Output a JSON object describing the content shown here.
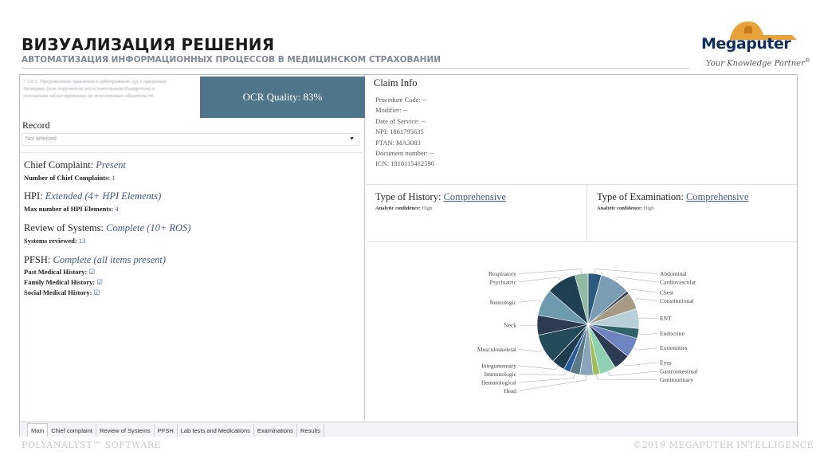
{
  "slide": {
    "title": "ВИЗУАЛИЗАЦИЯ РЕШЕНИЯ",
    "subtitle": "АВТОМАТИЗАЦИЯ ИНФОРМАЦИОННЫХ ПРОЦЕССОВ В МЕДИЦИНСКОМ СТРАХОВАНИИ",
    "logo_text": "Megaputer",
    "logo_tagline": "Your Knowledge Partner",
    "logo_tm": "®",
    "footer_left": "POLYANALYST™ SOFTWARE",
    "footer_right": "©2019 MEGAPUTER INTELLIGENCE"
  },
  "app": {
    "ocr_quality": "OCR Quality: 83%",
    "record_label": "Record",
    "record_select_value": "Not selected",
    "chief_complaint": {
      "label": "Chief Complaint:",
      "value": "Present",
      "sub_label": "Number of Chief Complaints:",
      "sub_value": "1"
    },
    "hpi": {
      "label": "HPI:",
      "value": "Extended (4+ HPI Elements)",
      "sub_label": "Max number of HPI Elements:",
      "sub_value": "4"
    },
    "ros": {
      "label": "Review of Systems:",
      "value": "Complete (10+ ROS)",
      "sub_label": "Systems reviewed:",
      "sub_value": "13"
    },
    "pfsh": {
      "label": "PFSH:",
      "value": "Complete (all items present)",
      "items": [
        {
          "label": "Past Medical History:",
          "check": "☑"
        },
        {
          "label": "Family Medical History:",
          "check": "☑"
        },
        {
          "label": "Social Medical History:",
          "check": "☑"
        }
      ]
    },
    "claim_info": {
      "title": "Claim Info",
      "fields": [
        "Procedure Code: --",
        "Modifier: --",
        "Date of Service: --",
        "NPI: 1861795635",
        "PTAN: MA3083",
        "Document number: --",
        "ICN: 1818115412590"
      ]
    },
    "type_of_history": {
      "label": "Type of History:",
      "value": "Comprehensive",
      "conf_label": "Analytic confidence:",
      "conf_value": "High"
    },
    "type_of_examination": {
      "label": "Type of Examination:",
      "value": "Comprehensive",
      "conf_label": "Analytic confidence:",
      "conf_value": "High"
    },
    "tabs": [
      "Main",
      "Chief complaint",
      "Review of Systems",
      "PFSH",
      "Lab tests and Medications",
      "Examinations",
      "Results"
    ],
    "active_tab": "Main"
  },
  "chart_data": {
    "type": "pie",
    "title": "",
    "slices": [
      {
        "label": "Abdominal",
        "value": 4,
        "color": "#2c5a7c"
      },
      {
        "label": "Cardiovascular",
        "value": 9,
        "color": "#7a9db4"
      },
      {
        "label": "Chest",
        "value": 1,
        "color": "#3a4a5a"
      },
      {
        "label": "Constitutional",
        "value": 5,
        "color": "#a59b84"
      },
      {
        "label": "ENT",
        "value": 6,
        "color": "#b9cfd8"
      },
      {
        "label": "Endocrine",
        "value": 3,
        "color": "#2f6168"
      },
      {
        "label": "Extremities",
        "value": 6,
        "color": "#6d84c0"
      },
      {
        "label": "Eyes",
        "value": 5,
        "color": "#2a3b52"
      },
      {
        "label": "Gastrointestinal",
        "value": 5,
        "color": "#8fd0b0"
      },
      {
        "label": "Genitourinary",
        "value": 2,
        "color": "#9ebb58"
      },
      {
        "label": "Head",
        "value": 4,
        "color": "#8aa5b8"
      },
      {
        "label": "Hematological",
        "value": 3,
        "color": "#5a7a8a"
      },
      {
        "label": "Immunologic",
        "value": 2,
        "color": "#2b5a98"
      },
      {
        "label": "Integumentary",
        "value": 4,
        "color": "#1d3d4f"
      },
      {
        "label": "Musculoskeletal",
        "value": 9,
        "color": "#234b58"
      },
      {
        "label": "Neck",
        "value": 6,
        "color": "#2d3b50"
      },
      {
        "label": "Neurologic",
        "value": 8,
        "color": "#6d9aad"
      },
      {
        "label": "Psychiatric",
        "value": 9,
        "color": "#1f3f52"
      },
      {
        "label": "Respiratory",
        "value": 4,
        "color": "#93b9a4"
      }
    ]
  }
}
